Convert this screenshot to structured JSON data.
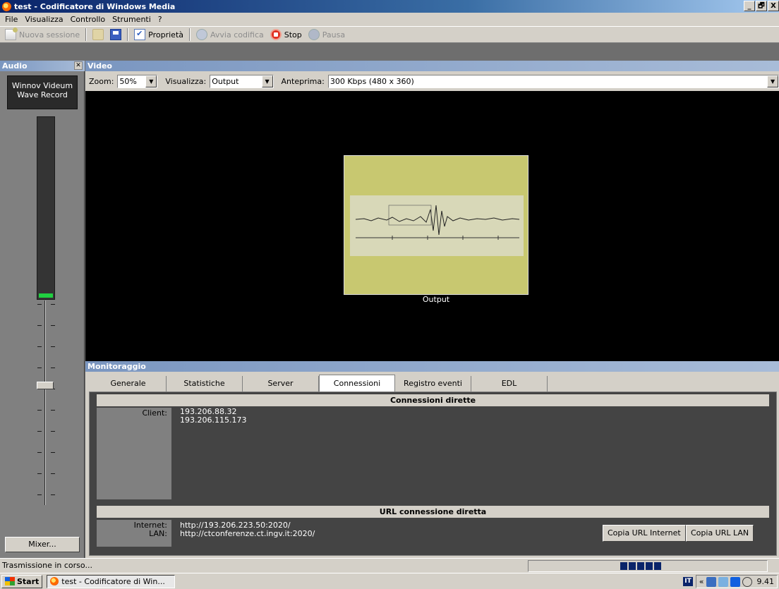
{
  "window": {
    "title": "test - Codificatore di Windows Media",
    "controls": [
      "_",
      "🗗",
      "X"
    ]
  },
  "menu": [
    "File",
    "Visualizza",
    "Controllo",
    "Strumenti",
    "?"
  ],
  "toolbar": {
    "new_session": "Nuova sessione",
    "properties": "Proprietà",
    "start_encoding": "Avvia codifica",
    "stop": "Stop",
    "pause": "Pausa"
  },
  "audio": {
    "title": "Audio",
    "close": "✕",
    "device": "Winnov Videum Wave Record",
    "mixer_button": "Mixer...",
    "level": 0.02
  },
  "video": {
    "title": "Video",
    "zoom_label": "Zoom:",
    "zoom_value": "50%",
    "view_label": "Visualizza:",
    "view_value": "Output",
    "preview_label": "Anteprima:",
    "preview_value": "300 Kbps (480 x 360)",
    "output_caption": "Output"
  },
  "monitor": {
    "title": "Monitoraggio",
    "tabs": [
      "Generale",
      "Statistiche",
      "Server",
      "Connessioni",
      "Registro eventi",
      "EDL"
    ],
    "active_tab": "Connessioni",
    "direct_connections_title": "Connessioni dirette",
    "client_label": "Client:",
    "clients": [
      "193.206.88.32",
      "193.206.115.173"
    ],
    "url_title": "URL connessione diretta",
    "internet_label": "Internet:",
    "lan_label": "LAN:",
    "internet_url": "http://193.206.223.50:2020/",
    "lan_url": "http://ctconferenze.ct.ingv.it:2020/",
    "copy_internet": "Copia URL Internet",
    "copy_lan": "Copia URL LAN"
  },
  "status": {
    "text": "Trasmissione in corso..."
  },
  "taskbar": {
    "start": "Start",
    "task": "test - Codificatore di Win...",
    "lang": "IT",
    "chevron": "«",
    "clock": "9.41"
  }
}
